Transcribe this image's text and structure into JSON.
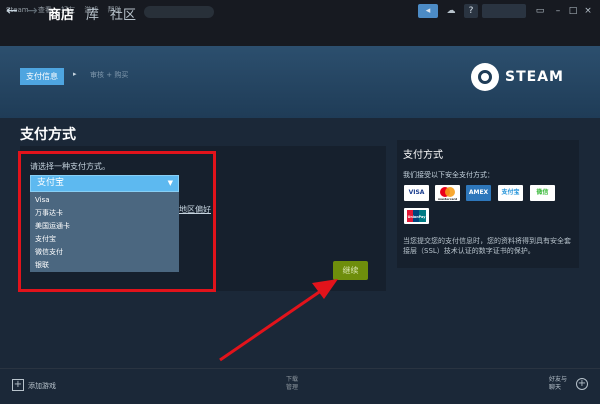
{
  "titlebar": {
    "menu": [
      "Steam",
      "查看",
      "好友",
      "游戏",
      "帮助"
    ],
    "help_icon_text": "?",
    "window_controls": {
      "minimize": "–",
      "maximize": "□",
      "close": "×"
    }
  },
  "nav": {
    "back": "←",
    "forward": "→",
    "tabs": [
      "商店",
      "库",
      "社区"
    ]
  },
  "steps": {
    "step1": "支付信息",
    "arrow": "▸",
    "step2": "审核 + 购买"
  },
  "brand": {
    "word": "STEAM"
  },
  "main": {
    "title": "支付方式",
    "prompt": "请选择一种支付方式。",
    "selected": "支付宝",
    "options": [
      "Visa",
      "万事达卡",
      "美国运通卡",
      "支付宝",
      "微信支付",
      "银联"
    ],
    "partial_text": "地区偏好",
    "continue_label": "继续"
  },
  "side": {
    "title": "支付方式",
    "accept_text": "我们接受以下安全支付方式：",
    "cards": [
      "VISA",
      "mastercard",
      "AMEX",
      "支付宝",
      "微信",
      "UnionPay"
    ],
    "note": "当您提交您的支付信息时，您的资料将得到具有安全套接层（SSL）技术认证的数字证书的保护。"
  },
  "footer": {
    "add_game": "添加游戏",
    "downloads_line1": "下载",
    "downloads_line2": "管理",
    "friends_line1": "好友与",
    "friends_line2": "聊天"
  },
  "colors": {
    "accent": "#4ea5e0",
    "highlight": "#e2131b",
    "continue": "#6e8e0c",
    "background": "#1b2838"
  }
}
